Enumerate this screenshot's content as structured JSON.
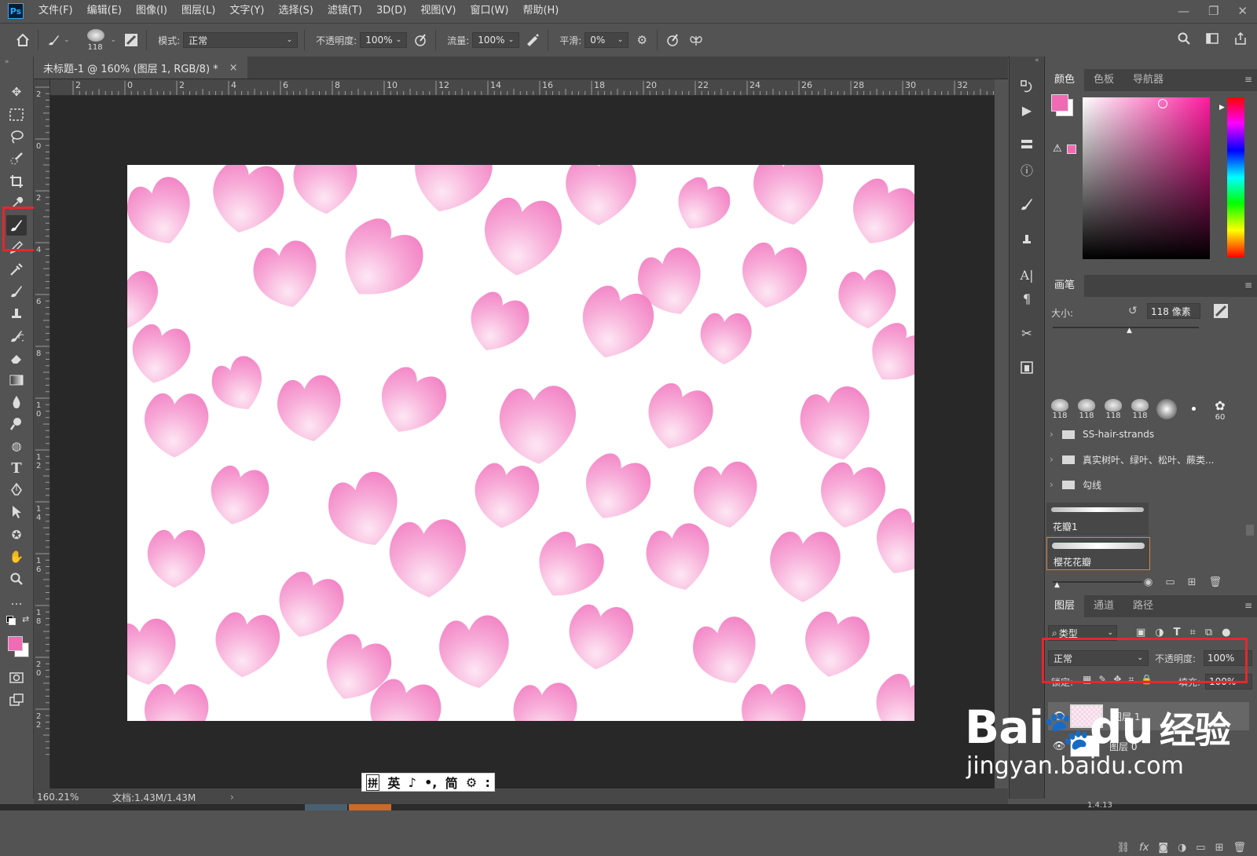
{
  "app": {
    "logo": "Ps",
    "menu": [
      "文件(F)",
      "编辑(E)",
      "图像(I)",
      "图层(L)",
      "文字(Y)",
      "选择(S)",
      "滤镜(T)",
      "3D(D)",
      "视图(V)",
      "窗口(W)",
      "帮助(H)"
    ],
    "window_controls": [
      "—",
      "❐",
      "✕"
    ]
  },
  "options_bar": {
    "brush_size": "118",
    "mode_label": "模式:",
    "mode_value": "正常",
    "opacity_label": "不透明度:",
    "opacity_value": "100%",
    "flow_label": "流量:",
    "flow_value": "100%",
    "smoothing_label": "平滑:",
    "smoothing_value": "0%"
  },
  "document": {
    "tab_title": "未标题-1 @ 160% (图层 1, RGB/8) *",
    "tab_close": "×",
    "ruler_top_labels": [
      "2",
      "0",
      "2",
      "4",
      "6",
      "8",
      "10",
      "12",
      "14",
      "16",
      "18",
      "20",
      "22",
      "24",
      "26",
      "28",
      "30",
      "32"
    ],
    "ruler_left_labels": [
      "2",
      "0",
      "2",
      "4",
      "6",
      "8",
      "1\n0",
      "1\n2",
      "1\n4",
      "1\n6",
      "1\n8",
      "2\n0",
      "2\n2"
    ],
    "zoom": "160.21%",
    "doc_size": "文档:1.43M/1.43M",
    "status_arrow": "›"
  },
  "ime": {
    "items": [
      "拼",
      "英",
      "♪",
      "•,",
      "简",
      "⚙",
      ":"
    ]
  },
  "color_panel": {
    "tabs": [
      "颜色",
      "色板",
      "导航器"
    ],
    "foreground": "#f06ab4",
    "background": "#ffffff"
  },
  "brush_panel": {
    "title": "画笔",
    "size_label": "大小:",
    "size_value": "118 像素",
    "presets": [
      "118",
      "118",
      "118",
      "118",
      "",
      "",
      "60"
    ],
    "folders": [
      "SS-hair-strands",
      "真实树叶、绿叶、松叶、蕨类...",
      "勾线"
    ],
    "brushes": [
      "花瓣1",
      "樱花花瓣"
    ]
  },
  "layers_panel": {
    "tabs": [
      "图层",
      "通道",
      "路径"
    ],
    "filter_label": "类型",
    "blend_mode": "正常",
    "opacity_label": "不透明度:",
    "opacity_value": "100%",
    "lock_label": "锁定:",
    "fill_label": "填充:",
    "fill_value": "100%",
    "layers": [
      {
        "name": "图层 1",
        "selected": true
      },
      {
        "name": "图层 0",
        "selected": false
      }
    ]
  },
  "watermark": {
    "brand": "Bai",
    "brand_mid": "du",
    "brand_cn": "经验",
    "url": "jingyan.baidu.com",
    "partial": "1.4.13"
  },
  "colors": {
    "accent_pink": "#f06ab4",
    "highlight_red": "#e8262b",
    "ui_bg": "#535353"
  }
}
